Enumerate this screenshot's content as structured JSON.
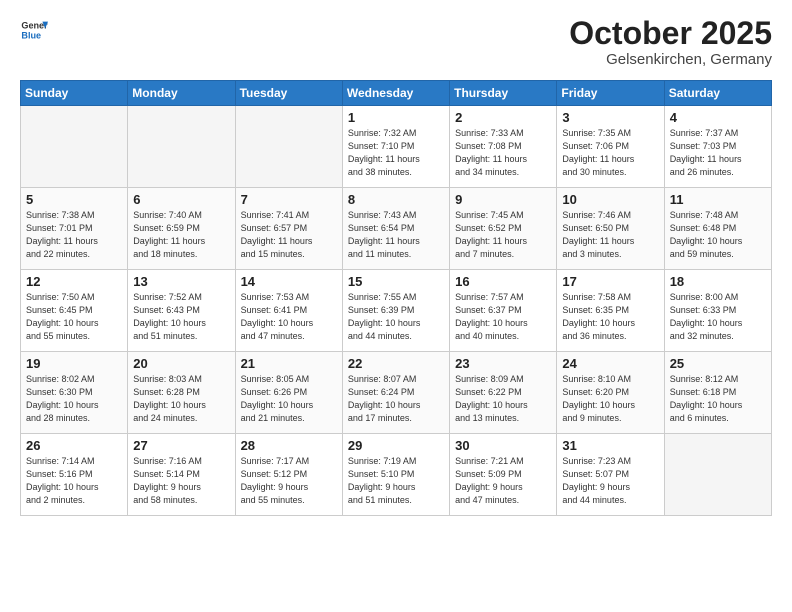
{
  "header": {
    "logo_general": "General",
    "logo_blue": "Blue",
    "month": "October 2025",
    "location": "Gelsenkirchen, Germany"
  },
  "days_of_week": [
    "Sunday",
    "Monday",
    "Tuesday",
    "Wednesday",
    "Thursday",
    "Friday",
    "Saturday"
  ],
  "weeks": [
    [
      {
        "num": "",
        "info": ""
      },
      {
        "num": "",
        "info": ""
      },
      {
        "num": "",
        "info": ""
      },
      {
        "num": "1",
        "info": "Sunrise: 7:32 AM\nSunset: 7:10 PM\nDaylight: 11 hours\nand 38 minutes."
      },
      {
        "num": "2",
        "info": "Sunrise: 7:33 AM\nSunset: 7:08 PM\nDaylight: 11 hours\nand 34 minutes."
      },
      {
        "num": "3",
        "info": "Sunrise: 7:35 AM\nSunset: 7:06 PM\nDaylight: 11 hours\nand 30 minutes."
      },
      {
        "num": "4",
        "info": "Sunrise: 7:37 AM\nSunset: 7:03 PM\nDaylight: 11 hours\nand 26 minutes."
      }
    ],
    [
      {
        "num": "5",
        "info": "Sunrise: 7:38 AM\nSunset: 7:01 PM\nDaylight: 11 hours\nand 22 minutes."
      },
      {
        "num": "6",
        "info": "Sunrise: 7:40 AM\nSunset: 6:59 PM\nDaylight: 11 hours\nand 18 minutes."
      },
      {
        "num": "7",
        "info": "Sunrise: 7:41 AM\nSunset: 6:57 PM\nDaylight: 11 hours\nand 15 minutes."
      },
      {
        "num": "8",
        "info": "Sunrise: 7:43 AM\nSunset: 6:54 PM\nDaylight: 11 hours\nand 11 minutes."
      },
      {
        "num": "9",
        "info": "Sunrise: 7:45 AM\nSunset: 6:52 PM\nDaylight: 11 hours\nand 7 minutes."
      },
      {
        "num": "10",
        "info": "Sunrise: 7:46 AM\nSunset: 6:50 PM\nDaylight: 11 hours\nand 3 minutes."
      },
      {
        "num": "11",
        "info": "Sunrise: 7:48 AM\nSunset: 6:48 PM\nDaylight: 10 hours\nand 59 minutes."
      }
    ],
    [
      {
        "num": "12",
        "info": "Sunrise: 7:50 AM\nSunset: 6:45 PM\nDaylight: 10 hours\nand 55 minutes."
      },
      {
        "num": "13",
        "info": "Sunrise: 7:52 AM\nSunset: 6:43 PM\nDaylight: 10 hours\nand 51 minutes."
      },
      {
        "num": "14",
        "info": "Sunrise: 7:53 AM\nSunset: 6:41 PM\nDaylight: 10 hours\nand 47 minutes."
      },
      {
        "num": "15",
        "info": "Sunrise: 7:55 AM\nSunset: 6:39 PM\nDaylight: 10 hours\nand 44 minutes."
      },
      {
        "num": "16",
        "info": "Sunrise: 7:57 AM\nSunset: 6:37 PM\nDaylight: 10 hours\nand 40 minutes."
      },
      {
        "num": "17",
        "info": "Sunrise: 7:58 AM\nSunset: 6:35 PM\nDaylight: 10 hours\nand 36 minutes."
      },
      {
        "num": "18",
        "info": "Sunrise: 8:00 AM\nSunset: 6:33 PM\nDaylight: 10 hours\nand 32 minutes."
      }
    ],
    [
      {
        "num": "19",
        "info": "Sunrise: 8:02 AM\nSunset: 6:30 PM\nDaylight: 10 hours\nand 28 minutes."
      },
      {
        "num": "20",
        "info": "Sunrise: 8:03 AM\nSunset: 6:28 PM\nDaylight: 10 hours\nand 24 minutes."
      },
      {
        "num": "21",
        "info": "Sunrise: 8:05 AM\nSunset: 6:26 PM\nDaylight: 10 hours\nand 21 minutes."
      },
      {
        "num": "22",
        "info": "Sunrise: 8:07 AM\nSunset: 6:24 PM\nDaylight: 10 hours\nand 17 minutes."
      },
      {
        "num": "23",
        "info": "Sunrise: 8:09 AM\nSunset: 6:22 PM\nDaylight: 10 hours\nand 13 minutes."
      },
      {
        "num": "24",
        "info": "Sunrise: 8:10 AM\nSunset: 6:20 PM\nDaylight: 10 hours\nand 9 minutes."
      },
      {
        "num": "25",
        "info": "Sunrise: 8:12 AM\nSunset: 6:18 PM\nDaylight: 10 hours\nand 6 minutes."
      }
    ],
    [
      {
        "num": "26",
        "info": "Sunrise: 7:14 AM\nSunset: 5:16 PM\nDaylight: 10 hours\nand 2 minutes."
      },
      {
        "num": "27",
        "info": "Sunrise: 7:16 AM\nSunset: 5:14 PM\nDaylight: 9 hours\nand 58 minutes."
      },
      {
        "num": "28",
        "info": "Sunrise: 7:17 AM\nSunset: 5:12 PM\nDaylight: 9 hours\nand 55 minutes."
      },
      {
        "num": "29",
        "info": "Sunrise: 7:19 AM\nSunset: 5:10 PM\nDaylight: 9 hours\nand 51 minutes."
      },
      {
        "num": "30",
        "info": "Sunrise: 7:21 AM\nSunset: 5:09 PM\nDaylight: 9 hours\nand 47 minutes."
      },
      {
        "num": "31",
        "info": "Sunrise: 7:23 AM\nSunset: 5:07 PM\nDaylight: 9 hours\nand 44 minutes."
      },
      {
        "num": "",
        "info": ""
      }
    ]
  ]
}
